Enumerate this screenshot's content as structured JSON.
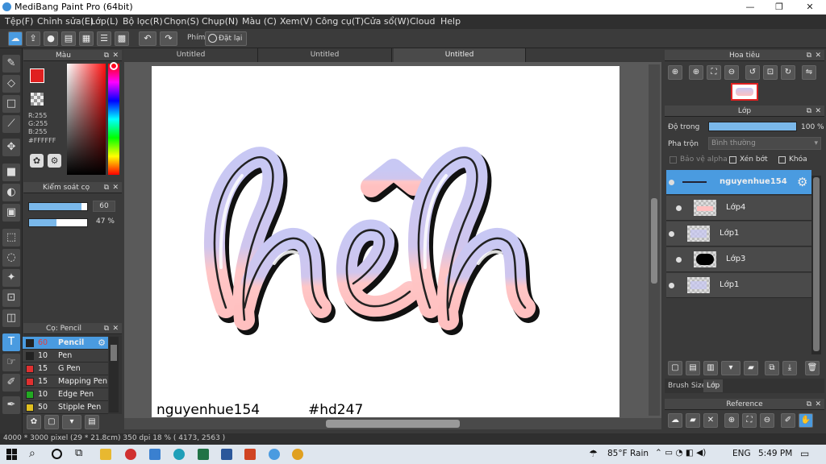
{
  "window": {
    "title": "MediBang Paint Pro (64bit)",
    "minimize": "—",
    "maximize": "❐",
    "close": "✕"
  },
  "menu": [
    "Tệp(F)",
    "Chỉnh sửa(E)",
    "Lớp(L)",
    "Bộ lọc(R)",
    "Chọn(S)",
    "Chụp(N)",
    "Màu (C)",
    "Xem(V)",
    "Công cụ(T)",
    "Cửa sổ(W)",
    "Cloud",
    "Help"
  ],
  "toolbar": {
    "shortcut_label": "Phím",
    "reset_label": "Đặt lại"
  },
  "tabs": [
    "Untitled",
    "Untitled",
    "Untitled"
  ],
  "color_panel": {
    "title": "Màu",
    "r": "R:255",
    "g": "G:255",
    "b": "B:255",
    "hex": "#FFFFFF"
  },
  "brush_control": {
    "title": "Kiểm soát cọ",
    "size_value": "60",
    "opacity_value": "47 %",
    "size_fraction": 0.9,
    "opacity_fraction": 0.47
  },
  "brush_list": {
    "title": "Cọ: Pencil",
    "items": [
      {
        "size": "60",
        "name": "Pencil",
        "color": "#222222",
        "selected": true
      },
      {
        "size": "10",
        "name": "Pen",
        "color": "#222222",
        "selected": false
      },
      {
        "size": "15",
        "name": "G Pen",
        "color": "#e03030",
        "selected": false
      },
      {
        "size": "15",
        "name": "Mapping Pen",
        "color": "#e03030",
        "selected": false
      },
      {
        "size": "10",
        "name": "Edge Pen",
        "color": "#22aa22",
        "selected": false
      },
      {
        "size": "50",
        "name": "Stipple Pen",
        "color": "#e0c020",
        "selected": false
      }
    ]
  },
  "canvas": {
    "artwork_text": "hêh",
    "caption_left": "nguyenhue154",
    "caption_right": "#hd247"
  },
  "navigator": {
    "title": "Hoa tiêu"
  },
  "layers": {
    "title": "Lớp",
    "opacity_label": "Độ trong",
    "opacity_value": "100 %",
    "opacity_fraction": 1.0,
    "blend_label": "Pha trộn",
    "blend_value": "Bình thường",
    "protect_alpha": "Bảo vệ alpha",
    "clipping": "Xén bớt",
    "lock": "Khóa",
    "items": [
      {
        "name": "nguyenhue154",
        "selected": true
      },
      {
        "name": "Lớp4",
        "selected": false
      },
      {
        "name": "Lớp1",
        "selected": false
      },
      {
        "name": "Lớp3",
        "selected": false
      },
      {
        "name": "Lớp1",
        "selected": false
      }
    ],
    "tab_brush_size": "Brush Size",
    "tab_layer": "Lớp"
  },
  "reference": {
    "title": "Reference"
  },
  "status": {
    "text": "4000 * 3000 pixel  (29 * 21.8cm)  350 dpi  18 %  ( 4173, 2563 )"
  },
  "taskbar": {
    "weather": "85°F  Rain",
    "lang": "ENG",
    "time": "5:49 PM"
  },
  "colors": {
    "accent": "#4a9be0",
    "panel": "#3a3a3a"
  }
}
